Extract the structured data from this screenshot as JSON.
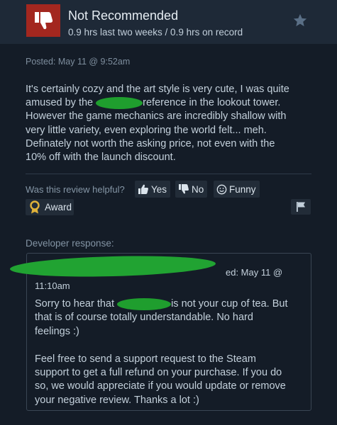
{
  "review": {
    "verdict": "Not Recommended",
    "hours": "0.9 hrs last two weeks / 0.9 hrs on record",
    "posted": "Posted: May 11 @ 9:52am",
    "body_lines": [
      [
        "It's certainly cozy and the art style is very cute, I was quite"
      ],
      [
        "amused by the ",
        "reference in the lookout tower."
      ],
      [
        "However the game mechanics are incredibly shallow with"
      ],
      [
        "very little variety, even exploring the world felt... meh."
      ],
      [
        "Definately not worth the asking price, not even with the"
      ],
      [
        "10% off with the launch discount."
      ]
    ],
    "redaction_color": "#1f9e2e",
    "thumb_color": "#a3271f"
  },
  "helpful": {
    "label": "Was this review helpful?",
    "yes": "Yes",
    "no": "No",
    "funny": "Funny",
    "award": "Award"
  },
  "developer": {
    "label": "Developer response:",
    "posted_partial": "ed: May 11 @",
    "time": "11:10am",
    "paragraph1": [
      "Sorry to hear that ",
      "is not your cup of tea. But",
      "that is of course totally understandable. No hard",
      "feelings :)"
    ],
    "paragraph2": [
      "Feel free to send a support request to the Steam",
      "support to get a full refund on your purchase. If you do",
      "so, we would appreciate if you would update or remove",
      "your negative review. Thanks a lot :)"
    ]
  },
  "icons": {
    "verdict": "thumbs-down-icon",
    "favorite": "star-icon",
    "yes": "thumbs-up-icon",
    "no": "thumbs-down-icon",
    "funny": "smiley-icon",
    "award": "award-medal-icon",
    "report": "flag-icon"
  }
}
